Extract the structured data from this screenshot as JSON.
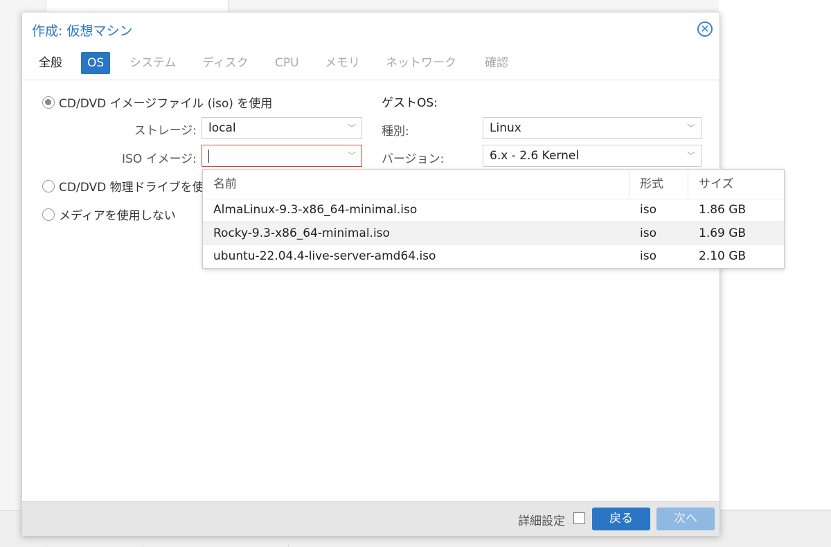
{
  "dialog": {
    "title": "作成: 仮想マシン",
    "close_icon": "close-circle-icon"
  },
  "tabs": [
    {
      "label": "全般"
    },
    {
      "label": "OS",
      "active": true
    },
    {
      "label": "システム"
    },
    {
      "label": "ディスク"
    },
    {
      "label": "CPU"
    },
    {
      "label": "メモリ"
    },
    {
      "label": "ネットワーク"
    },
    {
      "label": "確認"
    }
  ],
  "media": {
    "use_iso_label": "CD/DVD イメージファイル (iso) を使用",
    "storage_label": "ストレージ:",
    "storage_value": "local",
    "iso_label": "ISO イメージ:",
    "iso_value": "",
    "physical_drive_label": "CD/DVD 物理ドライブを使",
    "no_media_label": "メディアを使用しない",
    "selected": "iso"
  },
  "guest_os": {
    "title": "ゲストOS:",
    "type_label": "種別:",
    "type_value": "Linux",
    "version_label": "バージョン:",
    "version_value": "6.x - 2.6 Kernel"
  },
  "iso_dropdown": {
    "headers": {
      "name": "名前",
      "format": "形式",
      "size": "サイズ"
    },
    "rows": [
      {
        "name": "AlmaLinux-9.3-x86_64-minimal.iso",
        "format": "iso",
        "size": "1.86 GB"
      },
      {
        "name": "Rocky-9.3-x86_64-minimal.iso",
        "format": "iso",
        "size": "1.69 GB",
        "highlighted": true
      },
      {
        "name": "ubuntu-22.04.4-live-server-amd64.iso",
        "format": "iso",
        "size": "2.10 GB"
      }
    ]
  },
  "footer": {
    "advanced_label": "詳細設定",
    "back_label": "戻る",
    "next_label": "次へ"
  },
  "colors": {
    "accent": "#2b76c4",
    "invalid_border": "#cc4b37",
    "disabled_button": "#8fb8e2"
  }
}
